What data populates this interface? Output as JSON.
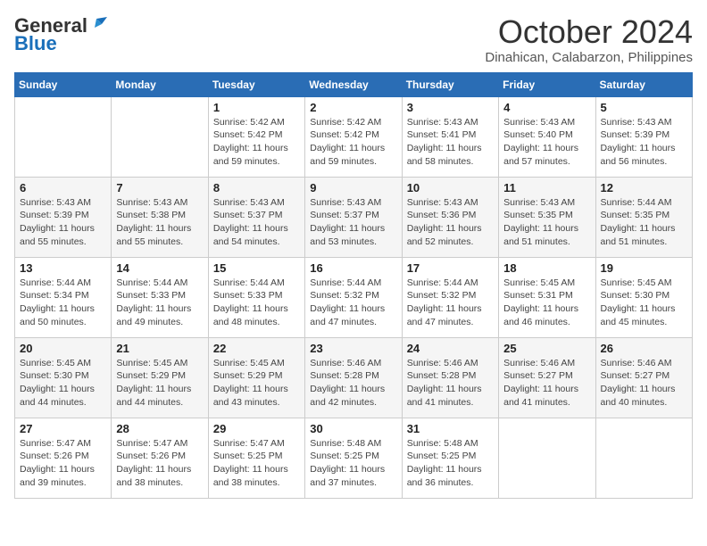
{
  "header": {
    "logo_general": "General",
    "logo_blue": "Blue",
    "month": "October 2024",
    "location": "Dinahican, Calabarzon, Philippines"
  },
  "weekdays": [
    "Sunday",
    "Monday",
    "Tuesday",
    "Wednesday",
    "Thursday",
    "Friday",
    "Saturday"
  ],
  "weeks": [
    [
      {
        "day": null,
        "sunrise": "",
        "sunset": "",
        "daylight": ""
      },
      {
        "day": null,
        "sunrise": "",
        "sunset": "",
        "daylight": ""
      },
      {
        "day": "1",
        "sunrise": "Sunrise: 5:42 AM",
        "sunset": "Sunset: 5:42 PM",
        "daylight": "Daylight: 11 hours and 59 minutes."
      },
      {
        "day": "2",
        "sunrise": "Sunrise: 5:42 AM",
        "sunset": "Sunset: 5:42 PM",
        "daylight": "Daylight: 11 hours and 59 minutes."
      },
      {
        "day": "3",
        "sunrise": "Sunrise: 5:43 AM",
        "sunset": "Sunset: 5:41 PM",
        "daylight": "Daylight: 11 hours and 58 minutes."
      },
      {
        "day": "4",
        "sunrise": "Sunrise: 5:43 AM",
        "sunset": "Sunset: 5:40 PM",
        "daylight": "Daylight: 11 hours and 57 minutes."
      },
      {
        "day": "5",
        "sunrise": "Sunrise: 5:43 AM",
        "sunset": "Sunset: 5:39 PM",
        "daylight": "Daylight: 11 hours and 56 minutes."
      }
    ],
    [
      {
        "day": "6",
        "sunrise": "Sunrise: 5:43 AM",
        "sunset": "Sunset: 5:39 PM",
        "daylight": "Daylight: 11 hours and 55 minutes."
      },
      {
        "day": "7",
        "sunrise": "Sunrise: 5:43 AM",
        "sunset": "Sunset: 5:38 PM",
        "daylight": "Daylight: 11 hours and 55 minutes."
      },
      {
        "day": "8",
        "sunrise": "Sunrise: 5:43 AM",
        "sunset": "Sunset: 5:37 PM",
        "daylight": "Daylight: 11 hours and 54 minutes."
      },
      {
        "day": "9",
        "sunrise": "Sunrise: 5:43 AM",
        "sunset": "Sunset: 5:37 PM",
        "daylight": "Daylight: 11 hours and 53 minutes."
      },
      {
        "day": "10",
        "sunrise": "Sunrise: 5:43 AM",
        "sunset": "Sunset: 5:36 PM",
        "daylight": "Daylight: 11 hours and 52 minutes."
      },
      {
        "day": "11",
        "sunrise": "Sunrise: 5:43 AM",
        "sunset": "Sunset: 5:35 PM",
        "daylight": "Daylight: 11 hours and 51 minutes."
      },
      {
        "day": "12",
        "sunrise": "Sunrise: 5:44 AM",
        "sunset": "Sunset: 5:35 PM",
        "daylight": "Daylight: 11 hours and 51 minutes."
      }
    ],
    [
      {
        "day": "13",
        "sunrise": "Sunrise: 5:44 AM",
        "sunset": "Sunset: 5:34 PM",
        "daylight": "Daylight: 11 hours and 50 minutes."
      },
      {
        "day": "14",
        "sunrise": "Sunrise: 5:44 AM",
        "sunset": "Sunset: 5:33 PM",
        "daylight": "Daylight: 11 hours and 49 minutes."
      },
      {
        "day": "15",
        "sunrise": "Sunrise: 5:44 AM",
        "sunset": "Sunset: 5:33 PM",
        "daylight": "Daylight: 11 hours and 48 minutes."
      },
      {
        "day": "16",
        "sunrise": "Sunrise: 5:44 AM",
        "sunset": "Sunset: 5:32 PM",
        "daylight": "Daylight: 11 hours and 47 minutes."
      },
      {
        "day": "17",
        "sunrise": "Sunrise: 5:44 AM",
        "sunset": "Sunset: 5:32 PM",
        "daylight": "Daylight: 11 hours and 47 minutes."
      },
      {
        "day": "18",
        "sunrise": "Sunrise: 5:45 AM",
        "sunset": "Sunset: 5:31 PM",
        "daylight": "Daylight: 11 hours and 46 minutes."
      },
      {
        "day": "19",
        "sunrise": "Sunrise: 5:45 AM",
        "sunset": "Sunset: 5:30 PM",
        "daylight": "Daylight: 11 hours and 45 minutes."
      }
    ],
    [
      {
        "day": "20",
        "sunrise": "Sunrise: 5:45 AM",
        "sunset": "Sunset: 5:30 PM",
        "daylight": "Daylight: 11 hours and 44 minutes."
      },
      {
        "day": "21",
        "sunrise": "Sunrise: 5:45 AM",
        "sunset": "Sunset: 5:29 PM",
        "daylight": "Daylight: 11 hours and 44 minutes."
      },
      {
        "day": "22",
        "sunrise": "Sunrise: 5:45 AM",
        "sunset": "Sunset: 5:29 PM",
        "daylight": "Daylight: 11 hours and 43 minutes."
      },
      {
        "day": "23",
        "sunrise": "Sunrise: 5:46 AM",
        "sunset": "Sunset: 5:28 PM",
        "daylight": "Daylight: 11 hours and 42 minutes."
      },
      {
        "day": "24",
        "sunrise": "Sunrise: 5:46 AM",
        "sunset": "Sunset: 5:28 PM",
        "daylight": "Daylight: 11 hours and 41 minutes."
      },
      {
        "day": "25",
        "sunrise": "Sunrise: 5:46 AM",
        "sunset": "Sunset: 5:27 PM",
        "daylight": "Daylight: 11 hours and 41 minutes."
      },
      {
        "day": "26",
        "sunrise": "Sunrise: 5:46 AM",
        "sunset": "Sunset: 5:27 PM",
        "daylight": "Daylight: 11 hours and 40 minutes."
      }
    ],
    [
      {
        "day": "27",
        "sunrise": "Sunrise: 5:47 AM",
        "sunset": "Sunset: 5:26 PM",
        "daylight": "Daylight: 11 hours and 39 minutes."
      },
      {
        "day": "28",
        "sunrise": "Sunrise: 5:47 AM",
        "sunset": "Sunset: 5:26 PM",
        "daylight": "Daylight: 11 hours and 38 minutes."
      },
      {
        "day": "29",
        "sunrise": "Sunrise: 5:47 AM",
        "sunset": "Sunset: 5:25 PM",
        "daylight": "Daylight: 11 hours and 38 minutes."
      },
      {
        "day": "30",
        "sunrise": "Sunrise: 5:48 AM",
        "sunset": "Sunset: 5:25 PM",
        "daylight": "Daylight: 11 hours and 37 minutes."
      },
      {
        "day": "31",
        "sunrise": "Sunrise: 5:48 AM",
        "sunset": "Sunset: 5:25 PM",
        "daylight": "Daylight: 11 hours and 36 minutes."
      },
      {
        "day": null,
        "sunrise": "",
        "sunset": "",
        "daylight": ""
      },
      {
        "day": null,
        "sunrise": "",
        "sunset": "",
        "daylight": ""
      }
    ]
  ]
}
